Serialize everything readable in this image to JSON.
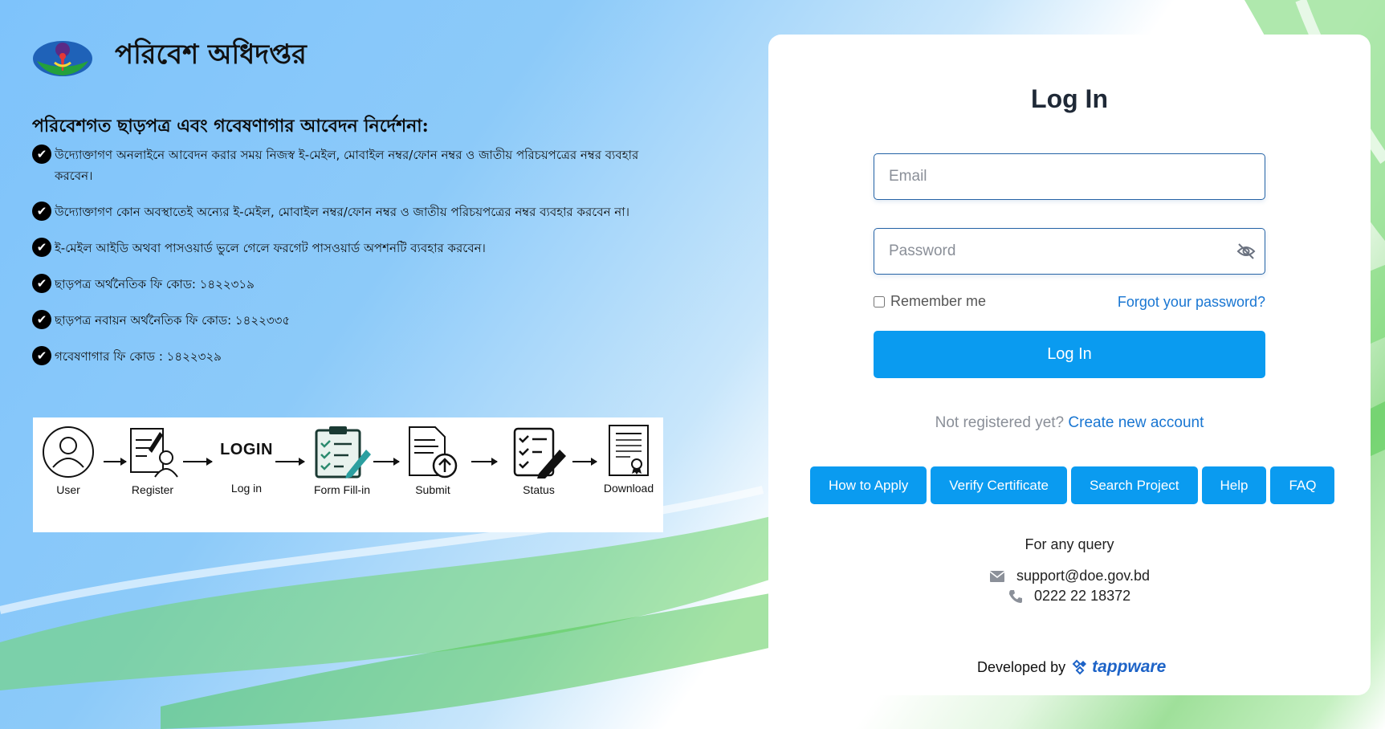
{
  "brand": {
    "title": "পরিবেশ অধিদপ্তর",
    "logo_icon": "doe-logo-icon"
  },
  "instructions": {
    "heading": "পরিবেশগত ছাড়পত্র এবং গবেষণাগার আবেদন নির্দেশনা:",
    "items": [
      "উদ্যোক্তাগণ অনলাইনে আবেদন করার সময় নিজস্ব ই-মেইল, মোবাইল নম্বর/ফোন নম্বর ও জাতীয় পরিচয়পত্রের নম্বর ব্যবহার করবেন।",
      "উদ্যোক্তাগণ কোন অবস্থাতেই অন্যের ই-মেইল, মোবাইল নম্বর/ফোন নম্বর ও জাতীয় পরিচয়পত্রের নম্বর ব্যবহার করবেন না।",
      "ই-মেইল আইডি অথবা পাসওয়ার্ড ভুলে গেলে ফরগেট পাসওয়ার্ড অপশনটি ব্যবহার করবেন।",
      "ছাড়পত্র অর্থনৈতিক ফি কোড: ১৪২২৩১৯",
      "ছাড়পত্র নবায়ন অর্থনৈতিক ফি কোড: ১৪২২৩৩৫",
      "গবেষণাগার ফি কোড : ১৪২২৩২৯"
    ]
  },
  "process": {
    "steps": [
      "User",
      "Register",
      "Log in",
      "Form Fill-in",
      "Submit",
      "Status",
      "Download"
    ],
    "login_word": "LOGIN"
  },
  "login": {
    "title": "Log In",
    "email_placeholder": "Email",
    "email_value": "",
    "password_placeholder": "Password",
    "password_value": "",
    "remember_label": "Remember me",
    "remember_checked": false,
    "forgot_label": "Forgot your password?",
    "submit_label": "Log In",
    "not_registered": "Not registered yet?",
    "create_account": "Create new account"
  },
  "quick_links": [
    "How to Apply",
    "Verify Certificate",
    "Search Project",
    "Help",
    "FAQ"
  ],
  "support": {
    "title": "For any query",
    "email": "support@doe.gov.bd",
    "phone": "0222 22 18372"
  },
  "footer": {
    "developed_by": "Developed by",
    "developer": "tappware"
  },
  "colors": {
    "primary": "#0a9bf0",
    "link": "#1976d2",
    "field_border": "#2563a6",
    "bg_blue": "#7ec3fb",
    "bg_green": "#9fe09a"
  }
}
